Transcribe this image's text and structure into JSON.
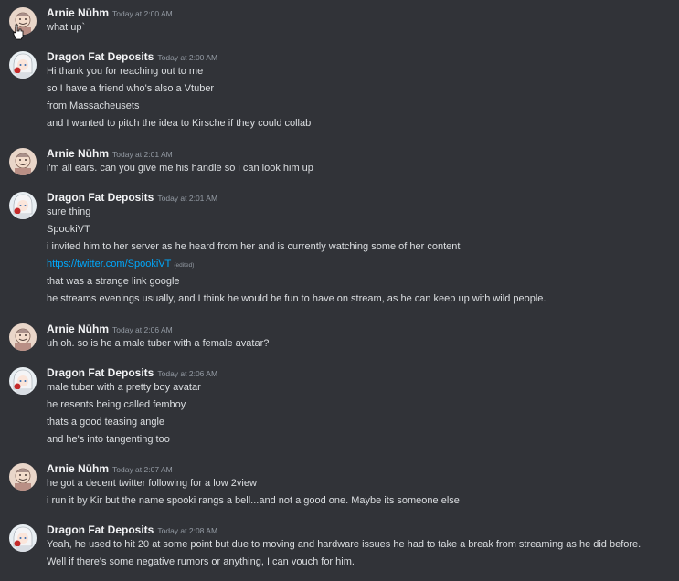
{
  "users": {
    "arnie": {
      "name": "Arnie Nūhm",
      "avatar_icon": "smiling-character-avatar-icon"
    },
    "dragon": {
      "name": "Dragon Fat Deposits",
      "avatar_icon": "white-haired-character-avatar-icon"
    }
  },
  "messages": [
    {
      "author": "Arnie Nūhm",
      "time": "Today at 2:00 AM",
      "lines": [
        "what up`"
      ]
    },
    {
      "author": "Dragon Fat Deposits",
      "time": "Today at 2:00 AM",
      "lines": [
        "Hi thank you for reaching out to me",
        "so I have a friend who's also a Vtuber",
        "from Massacheusets",
        "and I wanted to pitch the idea to Kirsche if they could collab"
      ]
    },
    {
      "author": "Arnie Nūhm",
      "time": "Today at 2:01 AM",
      "lines": [
        "i'm all ears. can you give me his handle so i can look him up"
      ]
    },
    {
      "author": "Dragon Fat Deposits",
      "time": "Today at 2:01 AM",
      "lines": [
        "sure thing",
        "SpookiVT",
        "i invited him to her server as he heard from her and is currently watching some of her content"
      ],
      "link": "https://twitter.com/SpookiVT",
      "edited_label": "(edited)",
      "lines_after": [
        "that was a strange link google",
        "he streams evenings usually, and I think he would be fun to have on stream, as he can keep up with wild people."
      ]
    },
    {
      "author": "Arnie Nūhm",
      "time": "Today at 2:06 AM",
      "lines": [
        "uh oh. so is he a male tuber with a female avatar?"
      ]
    },
    {
      "author": "Dragon Fat Deposits",
      "time": "Today at 2:06 AM",
      "lines": [
        "male tuber with a pretty boy avatar",
        "he resents being called femboy",
        "thats a good teasing angle",
        "and he's into tangenting too"
      ]
    },
    {
      "author": "Arnie Nūhm",
      "time": "Today at 2:07 AM",
      "lines": [
        "he got a decent twitter following for a low 2view",
        "i run it by Kir but the name spooki rangs a bell...and not a good one. Maybe its someone else"
      ]
    },
    {
      "author": "Dragon Fat Deposits",
      "time": "Today at 2:08 AM",
      "lines": [
        "Yeah, he used to hit 20 at some point but due to moving and hardware issues he had to take a break from streaming as he did before.",
        "Well if there's some negative rumors or anything, I can vouch for him."
      ]
    }
  ]
}
